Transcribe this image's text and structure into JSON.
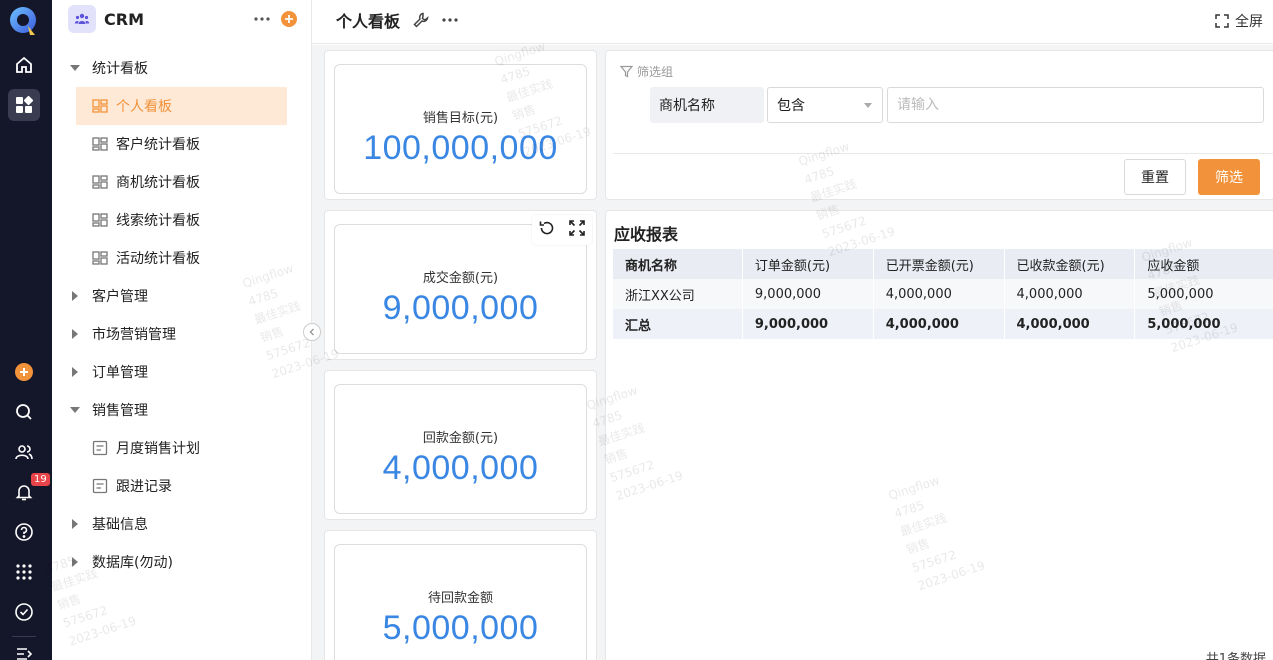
{
  "app": {
    "name": "CRM"
  },
  "nav": {
    "groups": [
      {
        "label": "统计看板",
        "expanded": true,
        "children": [
          {
            "label": "个人看板",
            "selected": true
          },
          {
            "label": "客户统计看板"
          },
          {
            "label": "商机统计看板"
          },
          {
            "label": "线索统计看板"
          },
          {
            "label": "活动统计看板"
          }
        ]
      },
      {
        "label": "客户管理",
        "expanded": false
      },
      {
        "label": "市场营销管理",
        "expanded": false
      },
      {
        "label": "订单管理",
        "expanded": false
      },
      {
        "label": "销售管理",
        "expanded": true,
        "children": [
          {
            "label": "月度销售计划"
          },
          {
            "label": "跟进记录"
          }
        ]
      },
      {
        "label": "基础信息",
        "expanded": false
      },
      {
        "label": "数据库(勿动)",
        "expanded": false
      }
    ]
  },
  "rail": {
    "notification_count": "19"
  },
  "header": {
    "title": "个人看板",
    "fullscreen_label": "全屏"
  },
  "kpis": [
    {
      "label": "销售目标(元)",
      "value": "100,000,000"
    },
    {
      "label": "成交金额(元)",
      "value": "9,000,000"
    },
    {
      "label": "回款金额(元)",
      "value": "4,000,000"
    },
    {
      "label": "待回款金额",
      "value": "5,000,000"
    }
  ],
  "filter": {
    "title": "筛选组",
    "field": "商机名称",
    "operator": "包含",
    "placeholder": "请输入",
    "reset_label": "重置",
    "submit_label": "筛选"
  },
  "report": {
    "title": "应收报表",
    "columns": [
      "商机名称",
      "订单金额(元)",
      "已开票金额(元)",
      "已收款金额(元)",
      "应收金额"
    ],
    "rows": [
      [
        "浙江XX公司",
        "9,000,000",
        "4,000,000",
        "4,000,000",
        "5,000,000"
      ]
    ],
    "total": [
      "汇总",
      "9,000,000",
      "4,000,000",
      "4,000,000",
      "5,000,000"
    ],
    "count_text": "共1条数据"
  },
  "watermark": [
    "Qingflow",
    "4785",
    "最佳实践",
    "销售",
    "575672",
    "2023-06-19"
  ],
  "colors": {
    "accent": "#f2923b",
    "kpi_value": "#3a86e3",
    "rail_bg": "#141629",
    "selected_bg": "#fde9d5"
  }
}
